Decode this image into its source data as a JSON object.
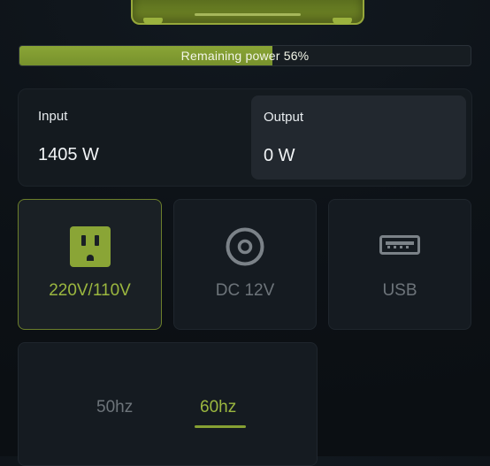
{
  "colors": {
    "accent": "#9bb73f",
    "battery_fill": "#86a033",
    "muted_text": "#6d747a",
    "card_bg": "#151b21"
  },
  "battery": {
    "label": "Remaining power 56%",
    "percent": 56
  },
  "power": {
    "input_label": "Input",
    "input_value": "1405 W",
    "output_label": "Output",
    "output_value": "0 W"
  },
  "output_types": [
    {
      "label": "220V/110V",
      "icon": "ac-outlet-icon",
      "selected": true
    },
    {
      "label": "DC 12V",
      "icon": "dc-port-icon",
      "selected": false
    },
    {
      "label": "USB",
      "icon": "usb-port-icon",
      "selected": false
    }
  ],
  "frequency": {
    "options": [
      {
        "label": "50hz",
        "selected": false
      },
      {
        "label": "60hz",
        "selected": true
      }
    ]
  }
}
